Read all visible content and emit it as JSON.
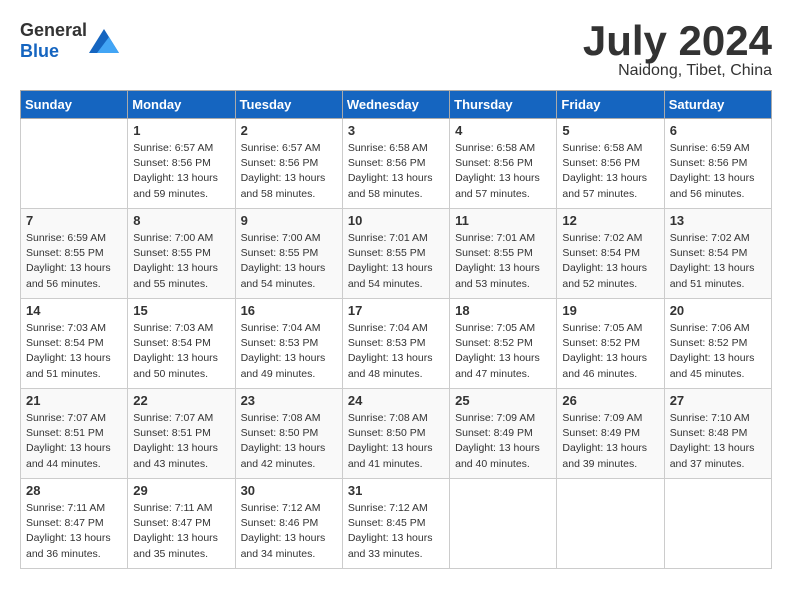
{
  "header": {
    "logo_general": "General",
    "logo_blue": "Blue",
    "month_year": "July 2024",
    "location": "Naidong, Tibet, China"
  },
  "days_of_week": [
    "Sunday",
    "Monday",
    "Tuesday",
    "Wednesday",
    "Thursday",
    "Friday",
    "Saturday"
  ],
  "weeks": [
    [
      {
        "day": "",
        "sunrise": "",
        "sunset": "",
        "daylight": ""
      },
      {
        "day": "1",
        "sunrise": "Sunrise: 6:57 AM",
        "sunset": "Sunset: 8:56 PM",
        "daylight": "Daylight: 13 hours and 59 minutes."
      },
      {
        "day": "2",
        "sunrise": "Sunrise: 6:57 AM",
        "sunset": "Sunset: 8:56 PM",
        "daylight": "Daylight: 13 hours and 58 minutes."
      },
      {
        "day": "3",
        "sunrise": "Sunrise: 6:58 AM",
        "sunset": "Sunset: 8:56 PM",
        "daylight": "Daylight: 13 hours and 58 minutes."
      },
      {
        "day": "4",
        "sunrise": "Sunrise: 6:58 AM",
        "sunset": "Sunset: 8:56 PM",
        "daylight": "Daylight: 13 hours and 57 minutes."
      },
      {
        "day": "5",
        "sunrise": "Sunrise: 6:58 AM",
        "sunset": "Sunset: 8:56 PM",
        "daylight": "Daylight: 13 hours and 57 minutes."
      },
      {
        "day": "6",
        "sunrise": "Sunrise: 6:59 AM",
        "sunset": "Sunset: 8:56 PM",
        "daylight": "Daylight: 13 hours and 56 minutes."
      }
    ],
    [
      {
        "day": "7",
        "sunrise": "Sunrise: 6:59 AM",
        "sunset": "Sunset: 8:55 PM",
        "daylight": "Daylight: 13 hours and 56 minutes."
      },
      {
        "day": "8",
        "sunrise": "Sunrise: 7:00 AM",
        "sunset": "Sunset: 8:55 PM",
        "daylight": "Daylight: 13 hours and 55 minutes."
      },
      {
        "day": "9",
        "sunrise": "Sunrise: 7:00 AM",
        "sunset": "Sunset: 8:55 PM",
        "daylight": "Daylight: 13 hours and 54 minutes."
      },
      {
        "day": "10",
        "sunrise": "Sunrise: 7:01 AM",
        "sunset": "Sunset: 8:55 PM",
        "daylight": "Daylight: 13 hours and 54 minutes."
      },
      {
        "day": "11",
        "sunrise": "Sunrise: 7:01 AM",
        "sunset": "Sunset: 8:55 PM",
        "daylight": "Daylight: 13 hours and 53 minutes."
      },
      {
        "day": "12",
        "sunrise": "Sunrise: 7:02 AM",
        "sunset": "Sunset: 8:54 PM",
        "daylight": "Daylight: 13 hours and 52 minutes."
      },
      {
        "day": "13",
        "sunrise": "Sunrise: 7:02 AM",
        "sunset": "Sunset: 8:54 PM",
        "daylight": "Daylight: 13 hours and 51 minutes."
      }
    ],
    [
      {
        "day": "14",
        "sunrise": "Sunrise: 7:03 AM",
        "sunset": "Sunset: 8:54 PM",
        "daylight": "Daylight: 13 hours and 51 minutes."
      },
      {
        "day": "15",
        "sunrise": "Sunrise: 7:03 AM",
        "sunset": "Sunset: 8:54 PM",
        "daylight": "Daylight: 13 hours and 50 minutes."
      },
      {
        "day": "16",
        "sunrise": "Sunrise: 7:04 AM",
        "sunset": "Sunset: 8:53 PM",
        "daylight": "Daylight: 13 hours and 49 minutes."
      },
      {
        "day": "17",
        "sunrise": "Sunrise: 7:04 AM",
        "sunset": "Sunset: 8:53 PM",
        "daylight": "Daylight: 13 hours and 48 minutes."
      },
      {
        "day": "18",
        "sunrise": "Sunrise: 7:05 AM",
        "sunset": "Sunset: 8:52 PM",
        "daylight": "Daylight: 13 hours and 47 minutes."
      },
      {
        "day": "19",
        "sunrise": "Sunrise: 7:05 AM",
        "sunset": "Sunset: 8:52 PM",
        "daylight": "Daylight: 13 hours and 46 minutes."
      },
      {
        "day": "20",
        "sunrise": "Sunrise: 7:06 AM",
        "sunset": "Sunset: 8:52 PM",
        "daylight": "Daylight: 13 hours and 45 minutes."
      }
    ],
    [
      {
        "day": "21",
        "sunrise": "Sunrise: 7:07 AM",
        "sunset": "Sunset: 8:51 PM",
        "daylight": "Daylight: 13 hours and 44 minutes."
      },
      {
        "day": "22",
        "sunrise": "Sunrise: 7:07 AM",
        "sunset": "Sunset: 8:51 PM",
        "daylight": "Daylight: 13 hours and 43 minutes."
      },
      {
        "day": "23",
        "sunrise": "Sunrise: 7:08 AM",
        "sunset": "Sunset: 8:50 PM",
        "daylight": "Daylight: 13 hours and 42 minutes."
      },
      {
        "day": "24",
        "sunrise": "Sunrise: 7:08 AM",
        "sunset": "Sunset: 8:50 PM",
        "daylight": "Daylight: 13 hours and 41 minutes."
      },
      {
        "day": "25",
        "sunrise": "Sunrise: 7:09 AM",
        "sunset": "Sunset: 8:49 PM",
        "daylight": "Daylight: 13 hours and 40 minutes."
      },
      {
        "day": "26",
        "sunrise": "Sunrise: 7:09 AM",
        "sunset": "Sunset: 8:49 PM",
        "daylight": "Daylight: 13 hours and 39 minutes."
      },
      {
        "day": "27",
        "sunrise": "Sunrise: 7:10 AM",
        "sunset": "Sunset: 8:48 PM",
        "daylight": "Daylight: 13 hours and 37 minutes."
      }
    ],
    [
      {
        "day": "28",
        "sunrise": "Sunrise: 7:11 AM",
        "sunset": "Sunset: 8:47 PM",
        "daylight": "Daylight: 13 hours and 36 minutes."
      },
      {
        "day": "29",
        "sunrise": "Sunrise: 7:11 AM",
        "sunset": "Sunset: 8:47 PM",
        "daylight": "Daylight: 13 hours and 35 minutes."
      },
      {
        "day": "30",
        "sunrise": "Sunrise: 7:12 AM",
        "sunset": "Sunset: 8:46 PM",
        "daylight": "Daylight: 13 hours and 34 minutes."
      },
      {
        "day": "31",
        "sunrise": "Sunrise: 7:12 AM",
        "sunset": "Sunset: 8:45 PM",
        "daylight": "Daylight: 13 hours and 33 minutes."
      },
      {
        "day": "",
        "sunrise": "",
        "sunset": "",
        "daylight": ""
      },
      {
        "day": "",
        "sunrise": "",
        "sunset": "",
        "daylight": ""
      },
      {
        "day": "",
        "sunrise": "",
        "sunset": "",
        "daylight": ""
      }
    ]
  ]
}
